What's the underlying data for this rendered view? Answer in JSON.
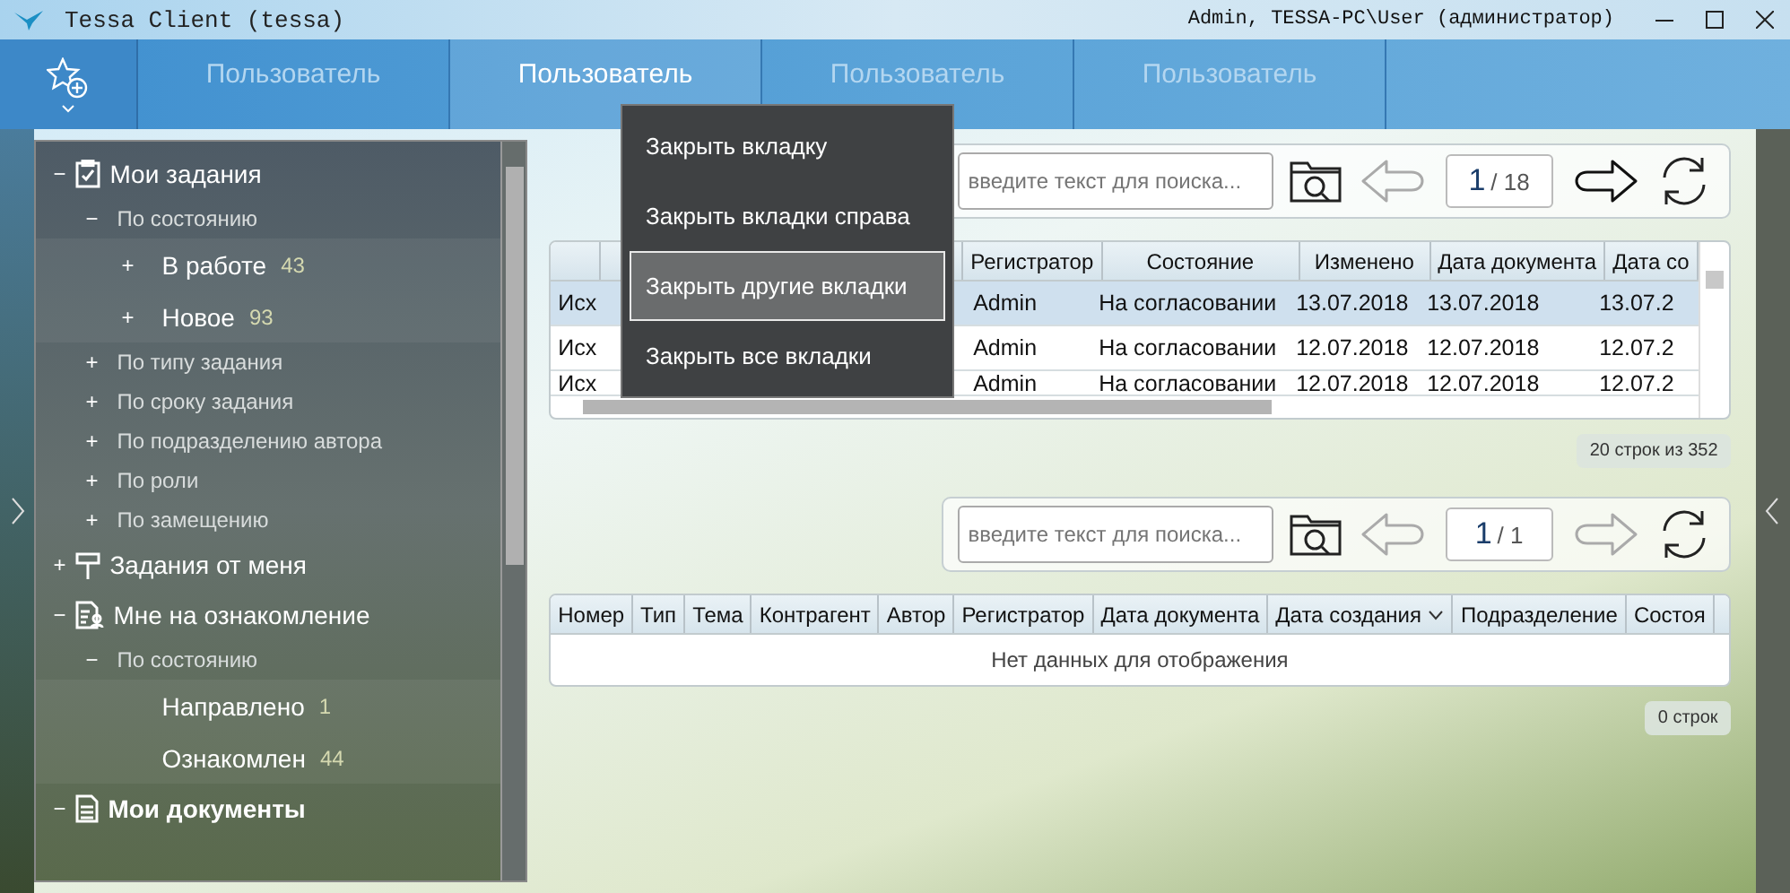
{
  "window": {
    "title": "Tessa Client (tessa)",
    "user": "Admin, TESSA-PC\\User (администратор)"
  },
  "tabs": [
    {
      "label": "Пользователь",
      "selected": false
    },
    {
      "label": "Пользователь",
      "selected": true
    },
    {
      "label": "Пользователь",
      "selected": false
    },
    {
      "label": "Пользователь",
      "selected": false
    }
  ],
  "context_menu": [
    {
      "label": "Закрыть вкладку",
      "selected": false
    },
    {
      "label": "Закрыть вкладки справа",
      "selected": false
    },
    {
      "label": "Закрыть другие вкладки",
      "selected": true
    },
    {
      "label": "Закрыть все вкладки",
      "selected": false
    }
  ],
  "sidebar": {
    "items": [
      {
        "label": "Мои задания",
        "kind": "clipboard",
        "toggle": "−",
        "children": [
          {
            "label": "По состоянию",
            "toggle": "−",
            "children": [
              {
                "label": "В работе",
                "count": "43",
                "toggle": "+"
              },
              {
                "label": "Новое",
                "count": "93",
                "toggle": "+"
              }
            ]
          },
          {
            "label": "По типу задания",
            "toggle": "+"
          },
          {
            "label": "По сроку задания",
            "toggle": "+"
          },
          {
            "label": "По подразделению автора",
            "toggle": "+"
          },
          {
            "label": "По роли",
            "toggle": "+"
          },
          {
            "label": "По замещению",
            "toggle": "+"
          }
        ]
      },
      {
        "label": "Задания от меня",
        "kind": "signpost",
        "toggle": "+"
      },
      {
        "label": "Мне на ознакомление",
        "kind": "document-person",
        "toggle": "−",
        "children": [
          {
            "label": "По состоянию",
            "toggle": "−",
            "children": [
              {
                "label": "Направлено",
                "count": "1"
              },
              {
                "label": "Ознакомлен",
                "count": "44"
              }
            ]
          }
        ]
      },
      {
        "label": "Мои документы",
        "kind": "document",
        "toggle": "−",
        "bold": true
      }
    ]
  },
  "grids": [
    {
      "search": {
        "placeholder": "введите текст для поиска..."
      },
      "page": "1",
      "pages": "/ 18",
      "prev_disabled": true,
      "next_disabled": false,
      "columns": [
        {},
        {},
        {},
        {
          "label": "Регистратор"
        },
        {
          "label": "Состояние"
        },
        {
          "label": "Изменено"
        },
        {
          "label": "Дата документа"
        },
        {
          "label": "Дата со"
        }
      ],
      "rows": [
        {
          "selected": true,
          "cells": [
            "Исх",
            null,
            null,
            "Admin",
            "На согласовании",
            "13.07.2018",
            "13.07.2018",
            "13.07.2"
          ]
        },
        {
          "selected": false,
          "cells": [
            "Исх",
            null,
            null,
            "Admin",
            "На согласовании",
            "12.07.2018",
            "12.07.2018",
            "12.07.2"
          ]
        },
        {
          "selected": false,
          "cells": [
            "Исх",
            null,
            null,
            "Admin",
            "На согласовании",
            "12.07.2018",
            "12.07.2018",
            "12.07.2"
          ]
        }
      ],
      "footer": "20 строк из 352"
    },
    {
      "search": {
        "placeholder": "введите текст для поиска..."
      },
      "page": "1",
      "pages": "/ 1",
      "prev_disabled": true,
      "next_disabled": true,
      "columns": [
        {
          "label": "Номер"
        },
        {
          "label": "Тип"
        },
        {
          "label": "Тема"
        },
        {
          "label": "Контрагент"
        },
        {
          "label": "Автор"
        },
        {
          "label": "Регистратор"
        },
        {
          "label": "Дата документа"
        },
        {
          "label": "Дата создания",
          "sorted": true
        },
        {
          "label": "Подразделение"
        },
        {
          "label": "Состоя"
        }
      ],
      "empty": "Нет данных для отображения",
      "footer": "0 строк"
    }
  ]
}
